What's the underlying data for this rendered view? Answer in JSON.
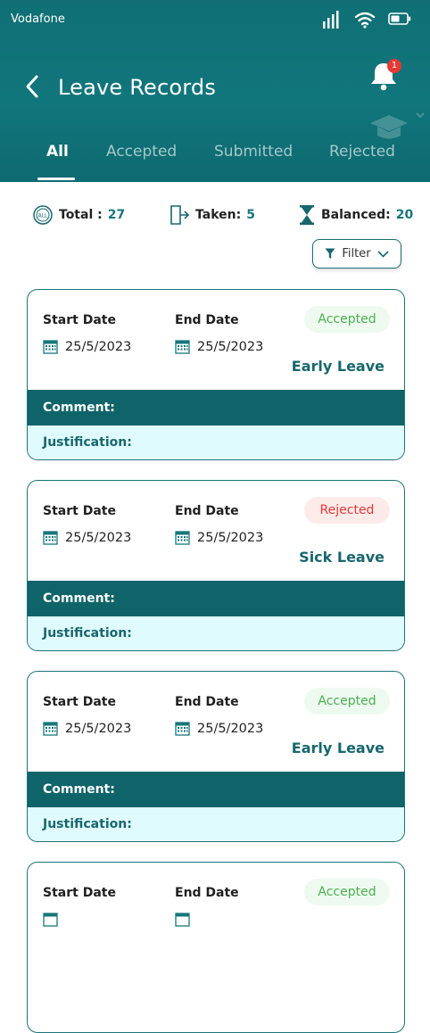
{
  "status_bar": {
    "carrier": "Vodafone"
  },
  "header": {
    "title": "Leave Records",
    "notification_count": "1"
  },
  "tabs": [
    {
      "label": "All",
      "active": true
    },
    {
      "label": "Accepted",
      "active": false
    },
    {
      "label": "Submitted",
      "active": false
    },
    {
      "label": "Rejected",
      "active": false
    }
  ],
  "stats": {
    "total_label": "Total :",
    "total_value": "27",
    "taken_label": "Taken:",
    "taken_value": "5",
    "balanced_label": "Balanced:",
    "balanced_value": "20",
    "all_icon_text": "ALL"
  },
  "filter": {
    "label": "Filter"
  },
  "records": [
    {
      "start_label": "Start Date",
      "start_date": "25/5/2023",
      "end_label": "End Date",
      "end_date": "25/5/2023",
      "status": "Accepted",
      "leave_type": "Early Leave",
      "comment_label": "Comment:",
      "justification_label": "Justification:"
    },
    {
      "start_label": "Start Date",
      "start_date": "25/5/2023",
      "end_label": "End Date",
      "end_date": "25/5/2023",
      "status": "Rejected",
      "leave_type": "Sick Leave",
      "comment_label": "Comment:",
      "justification_label": "Justification:"
    },
    {
      "start_label": "Start Date",
      "start_date": "25/5/2023",
      "end_label": "End Date",
      "end_date": "25/5/2023",
      "status": "Accepted",
      "leave_type": "Early Leave",
      "comment_label": "Comment:",
      "justification_label": "Justification:"
    },
    {
      "start_label": "Start Date",
      "start_date": "",
      "end_label": "End Date",
      "end_date": "",
      "status": "Accepted",
      "leave_type": "",
      "comment_label": "",
      "justification_label": ""
    }
  ],
  "colors": {
    "primary": "#0f6f74",
    "accepted_text": "#4caf50",
    "accepted_bg": "#eefaf0",
    "rejected_text": "#e53935",
    "rejected_bg": "#fdebea"
  },
  "icons": [
    "back-icon",
    "bell-icon",
    "graduation-cap-icon",
    "all-icon",
    "exit-door-icon",
    "hourglass-icon",
    "filter-icon",
    "chevron-down-icon",
    "calendar-icon",
    "signal-icon",
    "wifi-icon",
    "battery-icon"
  ]
}
